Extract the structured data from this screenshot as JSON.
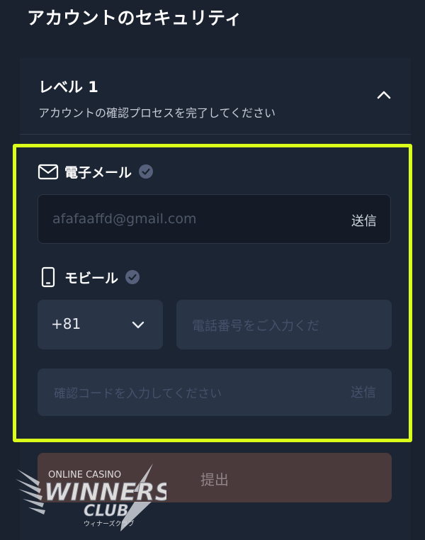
{
  "page": {
    "title": "アカウントのセキュリティ"
  },
  "level": {
    "title": "レベル 1",
    "subtitle": "アカウントの確認プロセスを完了してください"
  },
  "email": {
    "label": "電子メール",
    "value": "afafaaffd@gmail.com",
    "send_label": "送信",
    "icon": "mail-icon",
    "verified": true
  },
  "mobile": {
    "label": "モビール",
    "country_code": "+81",
    "phone_placeholder": "電話番号をご入力くだ",
    "code_placeholder": "確認コードを入力してください",
    "send_label": "送信",
    "icon": "mobile-phone-icon",
    "verified": true
  },
  "submit": {
    "label": "提出"
  },
  "watermark": {
    "line1": "ONLINE CASINO",
    "line2": "WINNERS",
    "line3": "CLUB",
    "line4": "ウィナーズクラブ"
  },
  "colors": {
    "background": "#1a2230",
    "highlight": "#d9ff1a",
    "input_bg": "#2a3447",
    "submit_bg": "#4b3a3b"
  }
}
